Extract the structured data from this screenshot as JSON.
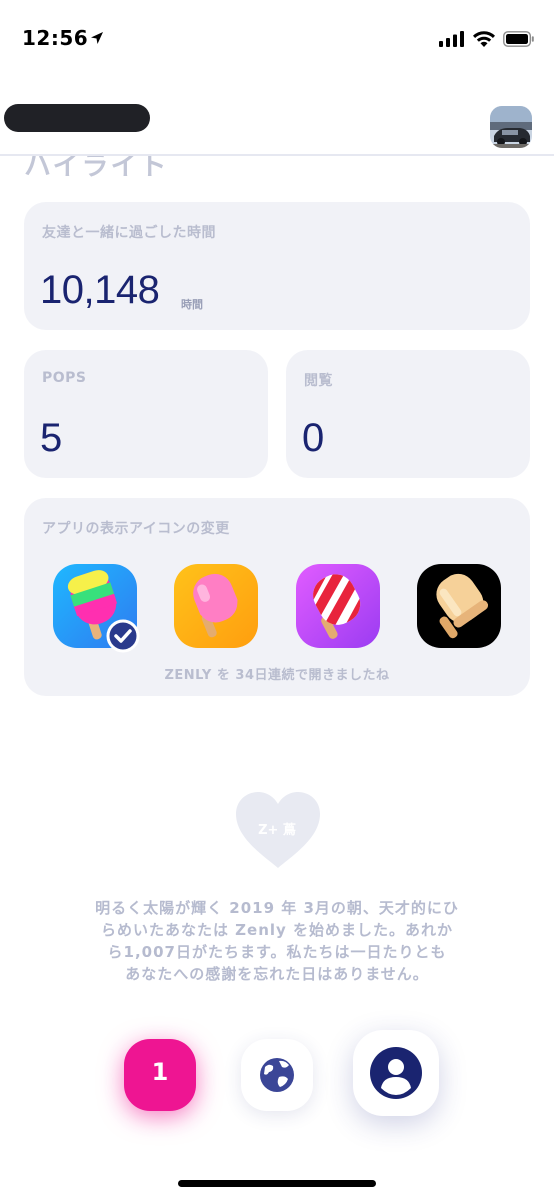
{
  "status_bar": {
    "time": "12:56"
  },
  "header": {
    "section_title": "ハイライト"
  },
  "cards": {
    "time_with_friends": {
      "label": "友達と一緒に過ごした時間",
      "value": "10,148",
      "unit": "時間"
    },
    "pops": {
      "label": "POPS",
      "value": "5"
    },
    "views": {
      "label": "閲覧",
      "value": "0"
    },
    "app_icon": {
      "label": "アプリの表示アイコンの変更",
      "streak_text": "ZENLY を 34日連続で開きましたね",
      "icons": [
        "rainbow-popsicle-icon",
        "pink-popsicle-icon",
        "candy-stripe-popsicle-icon",
        "cream-popsicle-icon"
      ]
    }
  },
  "heart": {
    "text": "Z+ 蔦"
  },
  "message": {
    "lines": [
      "明るく太陽が輝く 2019 年 3月の朝、天才的にひ",
      "らめいたあなたは Zenly を始めました。あれか",
      "ら1,007日がたちます。私たちは一日たりとも",
      "あなたへの感謝を忘れた日はありません。"
    ]
  },
  "bottom_nav": {
    "badge_count": "1",
    "globe_icon": "globe-icon",
    "profile_icon": "profile-icon"
  },
  "colors": {
    "accent_navy": "#1a2470",
    "pink": "#ee1592",
    "card_bg": "#f1f2f7",
    "muted_text": "#b9bdcf"
  }
}
